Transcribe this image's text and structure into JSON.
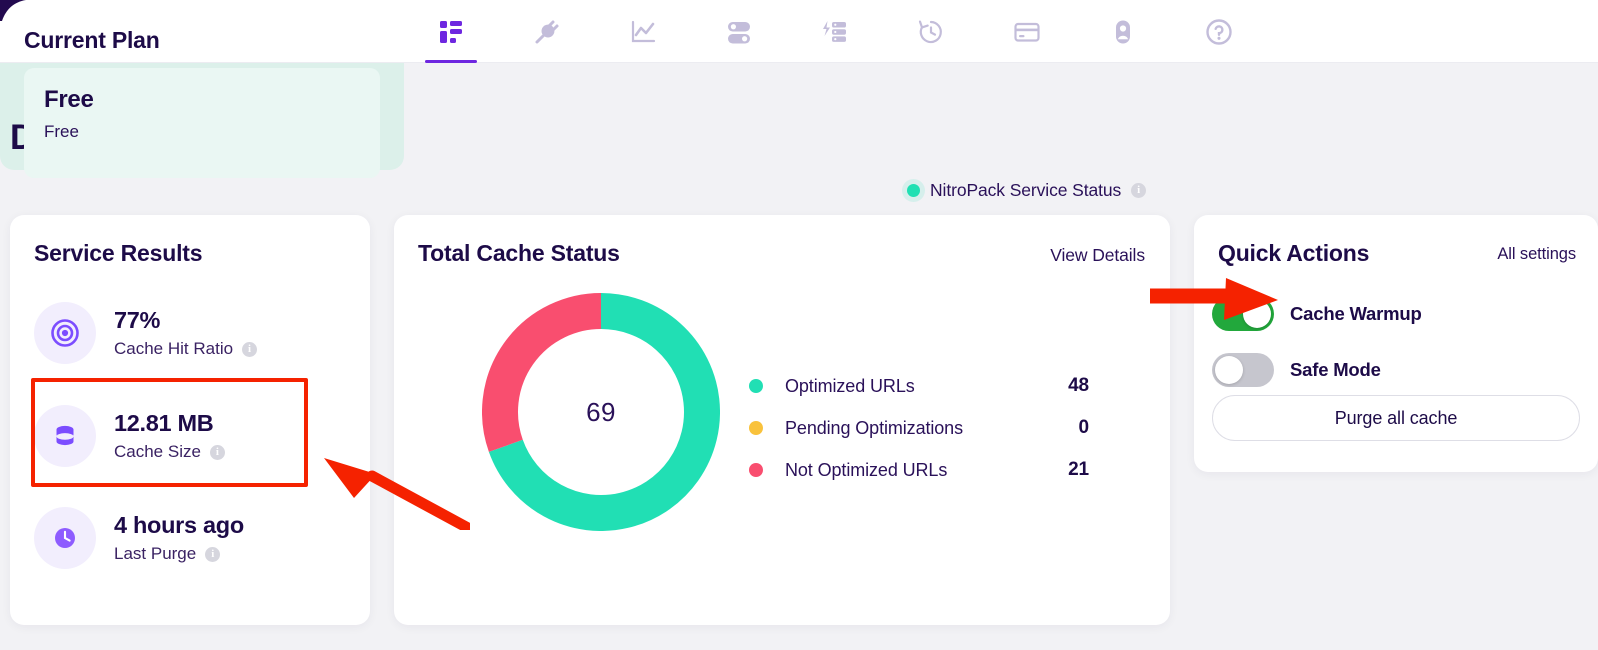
{
  "colors": {
    "accent_purple": "#6E27E0",
    "icon_purple": "#7C4DFF",
    "teal": "#21DFB4",
    "pink": "#F94E6F",
    "amber": "#F9C23C",
    "toggle_green": "#22A83C",
    "annotation_red": "#F52200",
    "title_ink": "#1D0B48",
    "page_bg": "#F2F2F5"
  },
  "nav": {
    "tabs": [
      {
        "name": "dashboard",
        "icon": "dashboard-icon",
        "active": true
      },
      {
        "name": "plugins",
        "icon": "plug-icon",
        "active": false
      },
      {
        "name": "analytics",
        "icon": "line-chart-icon",
        "active": false
      },
      {
        "name": "settings",
        "icon": "toggles-icon",
        "active": false
      },
      {
        "name": "optimization",
        "icon": "lightning-list-icon",
        "active": false
      },
      {
        "name": "history",
        "icon": "clock-rewind-icon",
        "active": false
      },
      {
        "name": "billing",
        "icon": "credit-card-icon",
        "active": false
      },
      {
        "name": "account",
        "icon": "user-icon",
        "active": false
      },
      {
        "name": "help",
        "icon": "question-mark-icon",
        "active": false
      }
    ]
  },
  "page": {
    "title": "Dashboard"
  },
  "service_status": {
    "label": "NitroPack Service Status",
    "state": "operational",
    "info_glyph": "i"
  },
  "service_results": {
    "title": "Service Results",
    "rows": [
      {
        "icon": "target-icon",
        "value": "77%",
        "label": "Cache Hit Ratio",
        "highlighted": false
      },
      {
        "icon": "database-icon",
        "value": "12.81 MB",
        "label": "Cache Size",
        "highlighted": true
      },
      {
        "icon": "clock-icon",
        "value": "4 hours ago",
        "label": "Last Purge",
        "highlighted": false
      }
    ]
  },
  "cache_status": {
    "title": "Total Cache Status",
    "view_details_label": "View Details"
  },
  "chart_data": {
    "type": "pie",
    "title": "Total Cache Status",
    "center_label": "69",
    "total": 69,
    "categories": [
      "Optimized URLs",
      "Pending Optimizations",
      "Not Optimized URLs"
    ],
    "values": [
      48,
      0,
      21
    ],
    "colors": [
      "#21DFB4",
      "#F9C23C",
      "#F94E6F"
    ],
    "legend_position": "right",
    "donut": true,
    "start_angle_deg": 0,
    "direction": "clockwise"
  },
  "quick_actions": {
    "title": "Quick Actions",
    "all_settings_label": "All settings",
    "toggles": [
      {
        "label": "Cache Warmup",
        "state": "on"
      },
      {
        "label": "Safe Mode",
        "state": "off"
      }
    ],
    "purge_button_label": "Purge all cache"
  },
  "current_plan": {
    "title": "Current Plan",
    "plan_name": "Free",
    "plan_sub": "Free"
  },
  "annotations": {
    "rect_target": "Cache Size service result row",
    "arrow_left_target": "Cache Size service result row",
    "arrow_right_target": "Cache Warmup toggle"
  }
}
